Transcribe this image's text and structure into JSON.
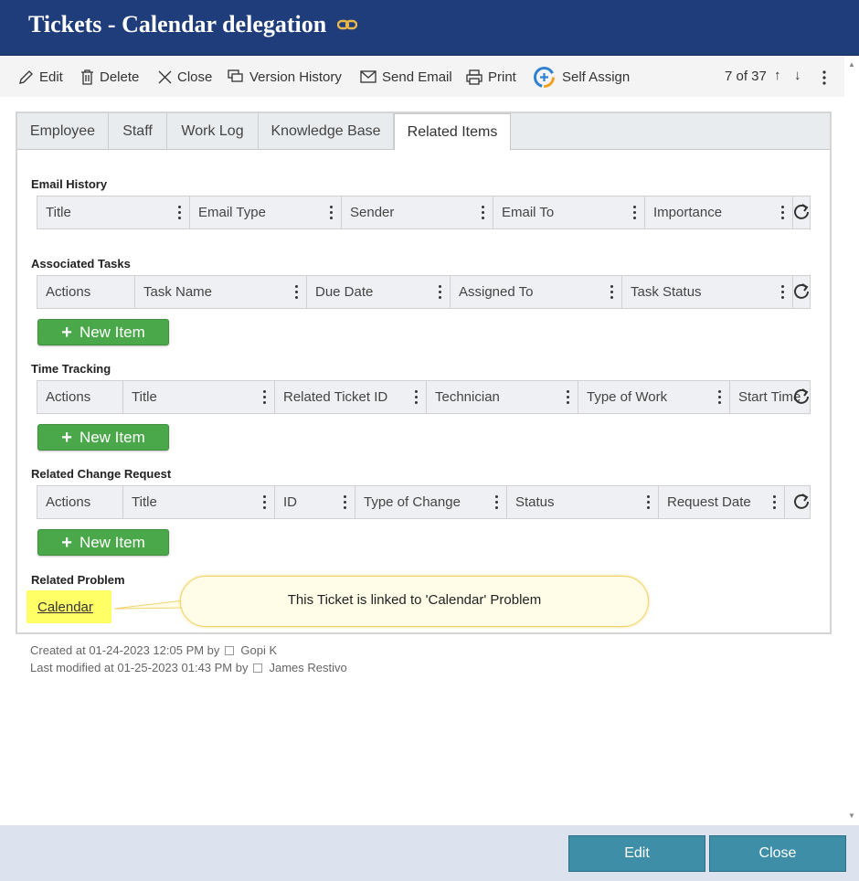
{
  "window": {
    "title": "Tickets - Calendar delegation"
  },
  "toolbar": {
    "edit": "Edit",
    "delete": "Delete",
    "close": "Close",
    "version_history": "Version History",
    "send_email": "Send Email",
    "print": "Print",
    "self_assign": "Self Assign",
    "pager": "7 of 37"
  },
  "tabs": [
    "Employee",
    "Staff",
    "Work Log",
    "Knowledge Base",
    "Related Items"
  ],
  "active_tab": "Related Items",
  "sections": {
    "email_history": {
      "title": "Email History",
      "columns": [
        "Title",
        "Email Type",
        "Sender",
        "Email To",
        "Importance"
      ]
    },
    "associated_tasks": {
      "title": "Associated Tasks",
      "columns": [
        "Actions",
        "Task Name",
        "Due Date",
        "Assigned To",
        "Task Status"
      ],
      "new_item": "New Item"
    },
    "time_tracking": {
      "title": "Time Tracking",
      "columns": [
        "Actions",
        "Title",
        "Related Ticket ID",
        "Technician",
        "Type of Work",
        "Start Time"
      ],
      "new_item": "New Item"
    },
    "related_change_request": {
      "title": "Related Change Request",
      "columns": [
        "Actions",
        "Title",
        "ID",
        "Type of Change",
        "Status",
        "Request Date"
      ],
      "new_item": "New Item"
    },
    "related_problem": {
      "title": "Related Problem",
      "link": "Calendar"
    }
  },
  "callout": "This Ticket is linked to 'Calendar' Problem",
  "meta": {
    "created_prefix": "Created at 01-24-2023 12:05 PM by",
    "created_by": "Gopi K",
    "modified_prefix": "Last modified at 01-25-2023 01:43 PM by",
    "modified_by": "James Restivo"
  },
  "footer": {
    "edit": "Edit",
    "close": "Close"
  },
  "colors": {
    "header": "#1f3d7a",
    "new_button": "#4aa84a",
    "footer_button": "#3f8ea8",
    "highlight": "#ffff66"
  }
}
